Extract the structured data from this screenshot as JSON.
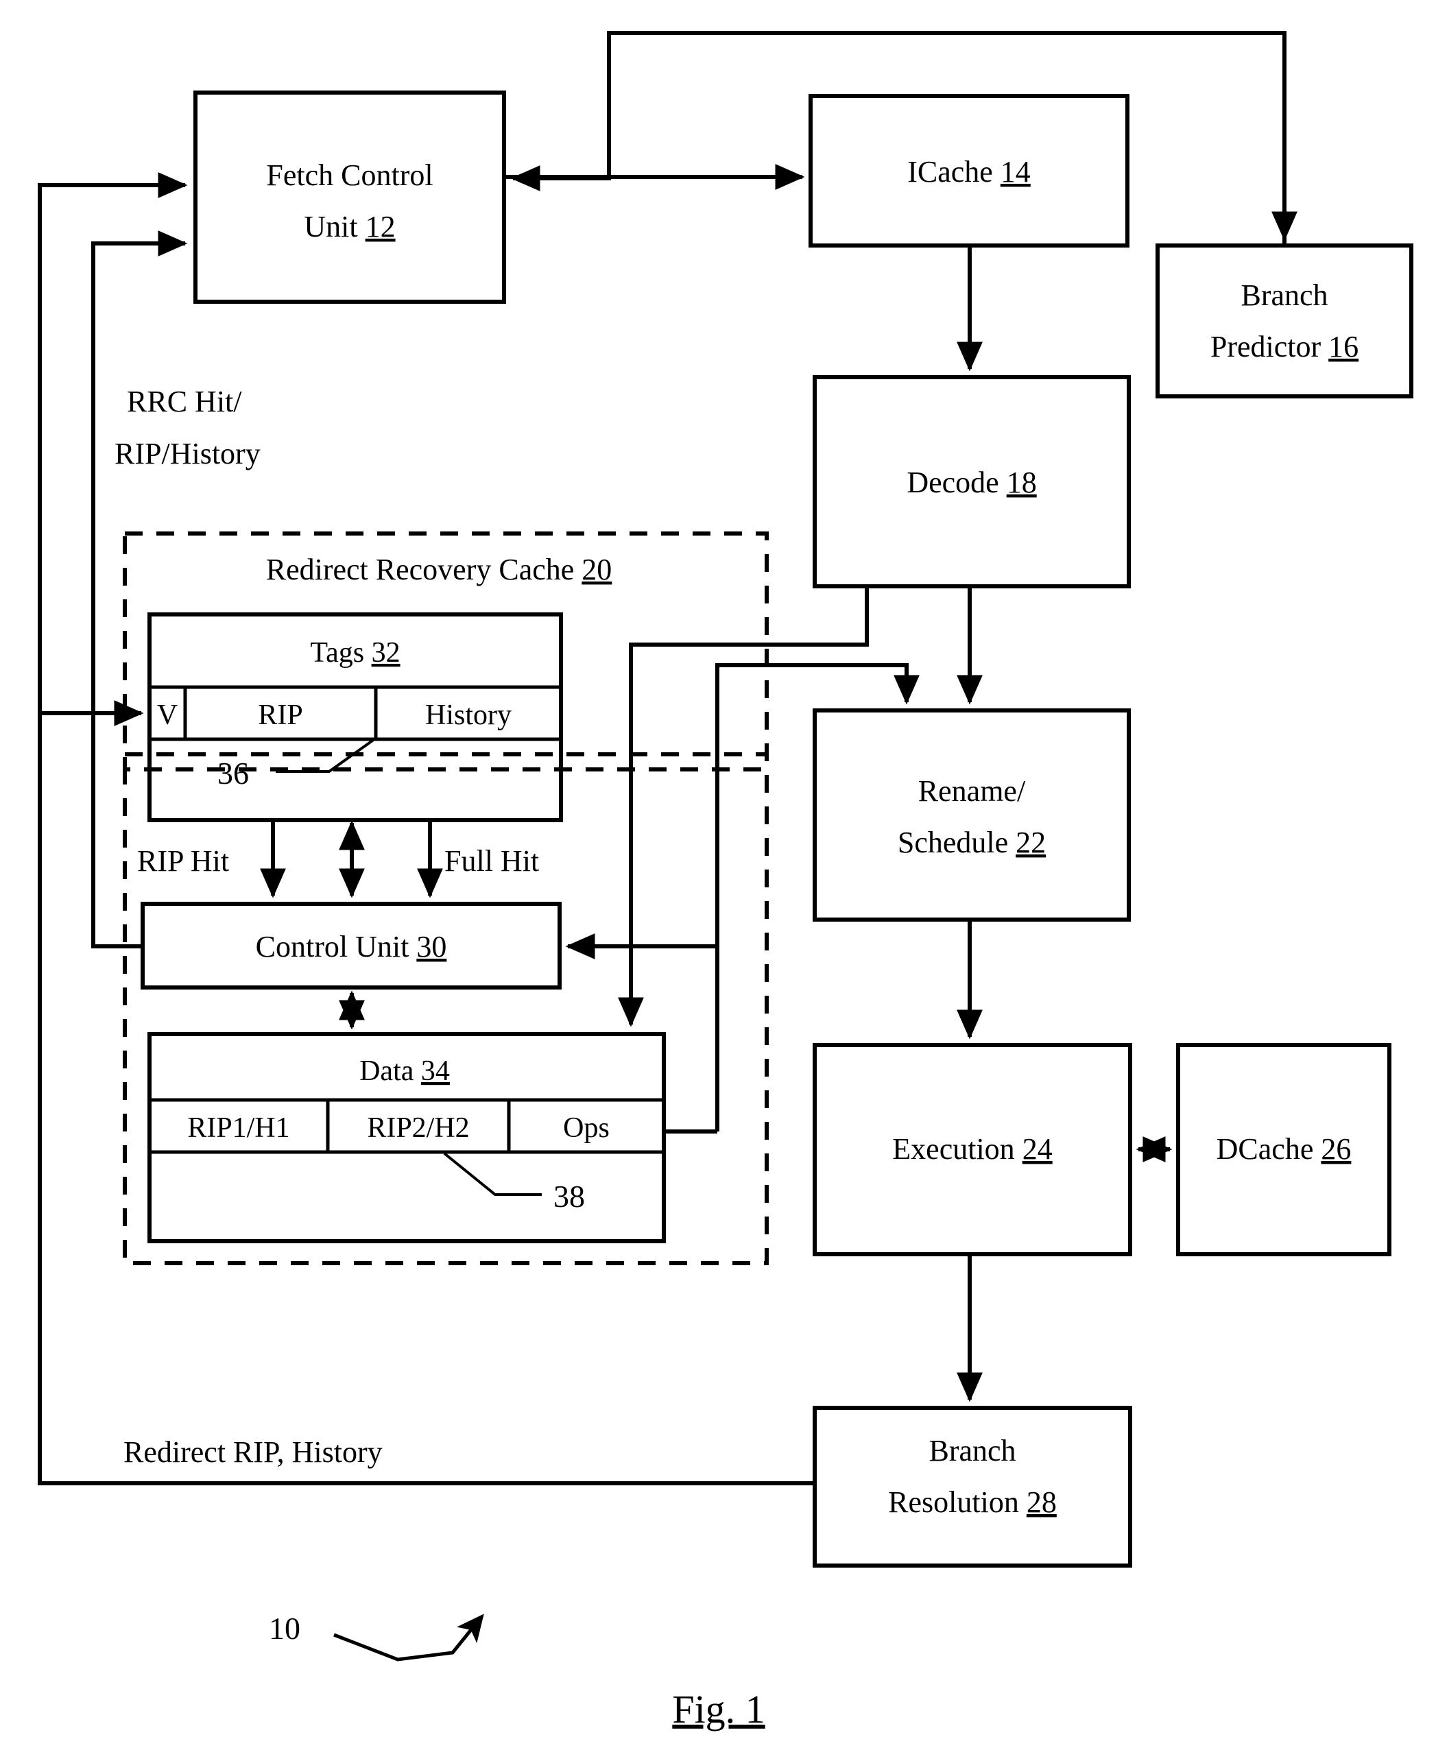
{
  "figure": {
    "caption": "Fig. 1",
    "system_ref": "10"
  },
  "blocks": {
    "fetch_control_unit": {
      "name": "Fetch Control",
      "name2": "Unit",
      "ref": "12"
    },
    "icache": {
      "name": "ICache",
      "ref": "14"
    },
    "branch_predictor": {
      "name": "Branch",
      "name2": "Predictor",
      "ref": "16"
    },
    "decode": {
      "name": "Decode",
      "ref": "18"
    },
    "rename_schedule": {
      "name": "Rename/",
      "name2": "Schedule",
      "ref": "22"
    },
    "execution": {
      "name": "Execution",
      "ref": "24"
    },
    "dcache": {
      "name": "DCache",
      "ref": "26"
    },
    "branch_resolution": {
      "name": "Branch",
      "name2": "Resolution",
      "ref": "28"
    },
    "control_unit": {
      "name": "Control Unit",
      "ref": "30"
    }
  },
  "rrc": {
    "title": "Redirect Recovery Cache",
    "ref": "20",
    "tags": {
      "title": "Tags",
      "ref": "32",
      "entry_ref": "36",
      "columns": [
        "V",
        "RIP",
        "History"
      ]
    },
    "data": {
      "title": "Data",
      "ref": "34",
      "entry_ref": "38",
      "columns": [
        "RIP1/H1",
        "RIP2/H2",
        "Ops"
      ]
    }
  },
  "signals": {
    "rrc_hit_line1": "RRC Hit/",
    "rrc_hit_line2": "RIP/History",
    "rip_hit": "RIP Hit",
    "full_hit": "Full Hit",
    "redirect": "Redirect RIP, History"
  },
  "colors": {
    "ink": "#000000",
    "paper": "#ffffff"
  }
}
